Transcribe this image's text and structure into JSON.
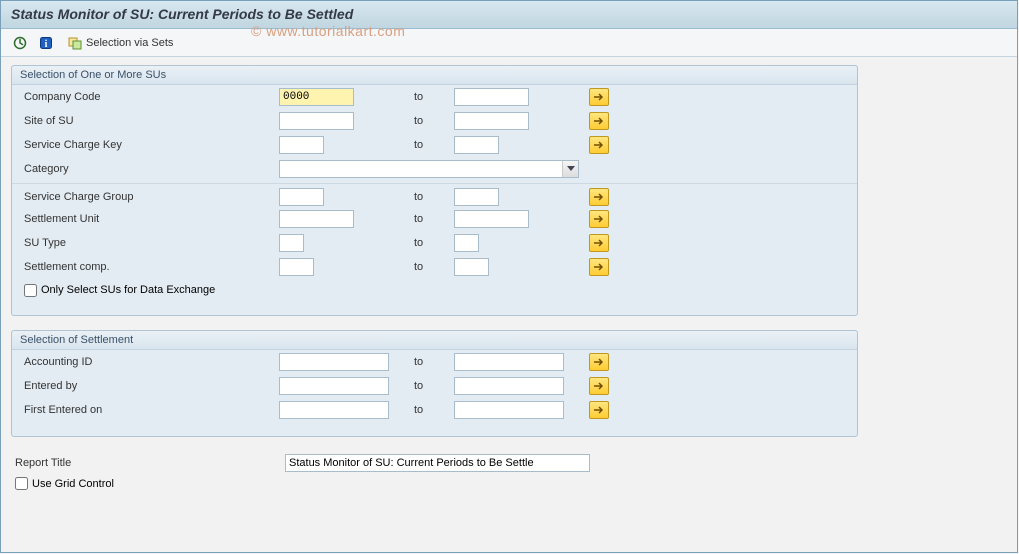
{
  "header": {
    "title": "Status Monitor of SU: Current Periods to Be Settled"
  },
  "toolbar": {
    "execute_icon": "execute",
    "info_icon": "info",
    "sets_icon": "sets",
    "sets_label": "Selection via Sets"
  },
  "watermark": "© www.tutorialkart.com",
  "panel1": {
    "title": "Selection of One or More SUs",
    "rows": {
      "company_code": {
        "label": "Company Code",
        "from": "0000",
        "to_label": "to",
        "to": ""
      },
      "site": {
        "label": "Site of SU",
        "from": "",
        "to_label": "to",
        "to": ""
      },
      "sc_key": {
        "label": "Service Charge Key",
        "from": "",
        "to_label": "to",
        "to": ""
      },
      "category": {
        "label": "Category",
        "value": ""
      },
      "sc_group": {
        "label": "Service Charge Group",
        "from": "",
        "to_label": "to",
        "to": ""
      },
      "settlement_unit": {
        "label": "Settlement Unit",
        "from": "",
        "to_label": "to",
        "to": ""
      },
      "su_type": {
        "label": "SU Type",
        "from": "",
        "to_label": "to",
        "to": ""
      },
      "settlement_comp": {
        "label": "Settlement comp.",
        "from": "",
        "to_label": "to",
        "to": ""
      }
    },
    "only_select_label": "Only Select SUs for Data Exchange",
    "only_select_checked": false
  },
  "panel2": {
    "title": "Selection of Settlement",
    "rows": {
      "accounting_id": {
        "label": "Accounting ID",
        "from": "",
        "to_label": "to",
        "to": ""
      },
      "entered_by": {
        "label": "Entered by",
        "from": "",
        "to_label": "to",
        "to": ""
      },
      "first_entered": {
        "label": "First Entered on",
        "from": "",
        "to_label": "to",
        "to": ""
      }
    }
  },
  "footer": {
    "report_title_label": "Report Title",
    "report_title_value": "Status Monitor of SU: Current Periods to Be Settle",
    "use_grid_label": "Use Grid Control",
    "use_grid_checked": false
  }
}
